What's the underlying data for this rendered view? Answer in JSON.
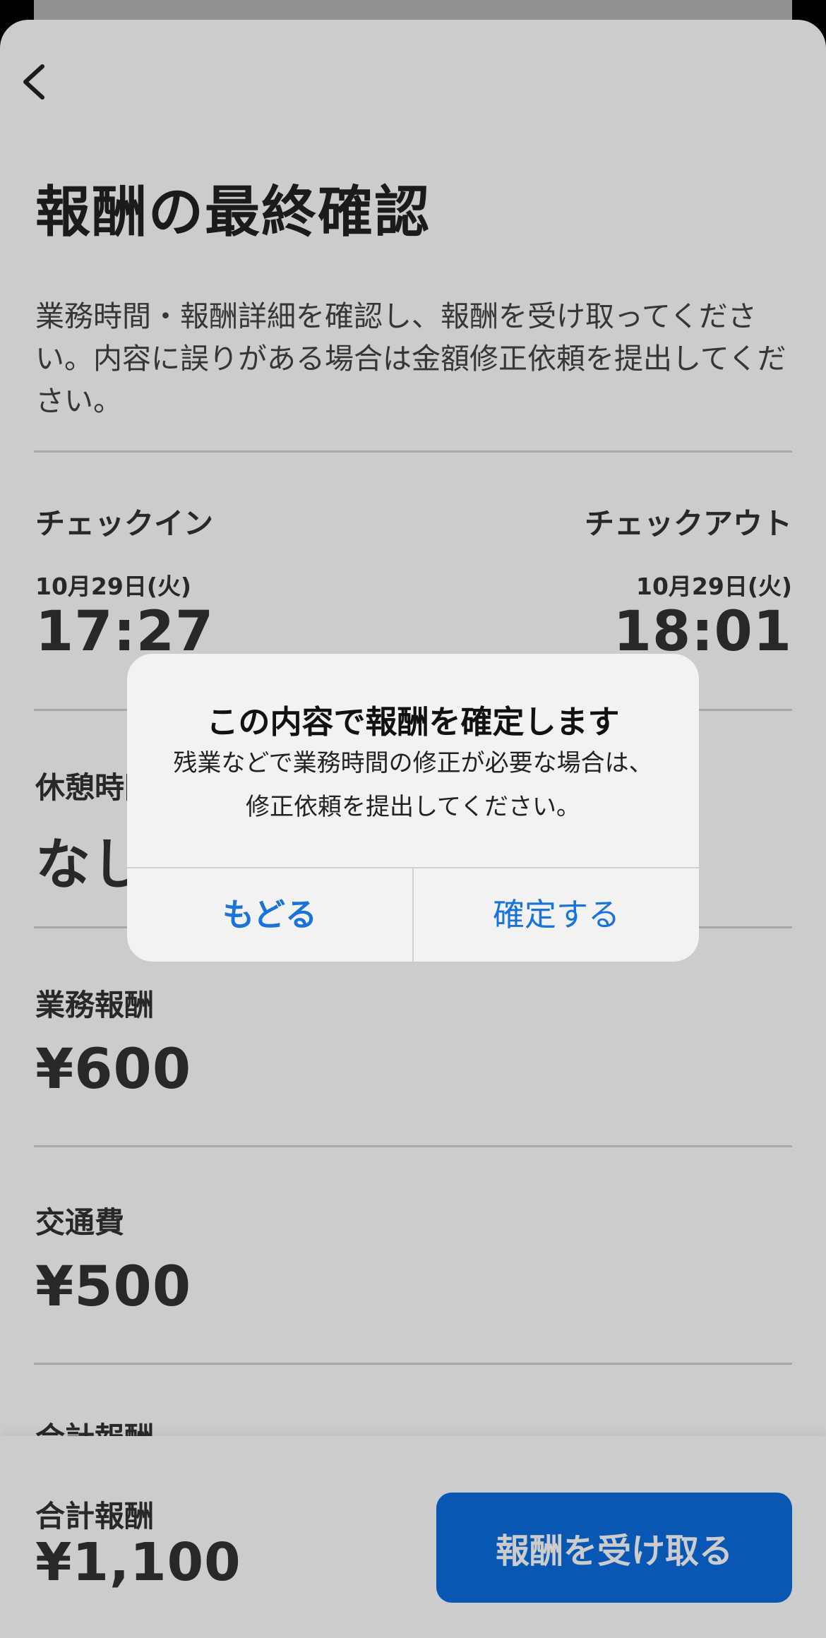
{
  "page": {
    "title": "報酬の最終確認",
    "description": "業務時間・報酬詳細を確認し、報酬を受け取ってください。内容に誤りがある場合は金額修正依頼を提出してください。"
  },
  "checkin": {
    "label": "チェックイン",
    "date": "10月29日(火)",
    "time": "17:27"
  },
  "checkout": {
    "label": "チェックアウト",
    "date": "10月29日(火)",
    "time": "18:01"
  },
  "break": {
    "label": "休憩時間",
    "value": "なし"
  },
  "work_pay": {
    "label": "業務報酬",
    "value": "¥600"
  },
  "transport": {
    "label": "交通費",
    "value": "¥500"
  },
  "total_peek": {
    "label": "合計報酬"
  },
  "bottom": {
    "total_label": "合計報酬",
    "total_value": "¥1,100",
    "cta_label": "報酬を受け取る"
  },
  "dialog": {
    "title": "この内容で報酬を確定します",
    "message_line1": "残業などで業務時間の修正が必要な場合は、",
    "message_line2": "修正依頼を提出してください。",
    "cancel_label": "もどる",
    "confirm_label": "確定する"
  },
  "colors": {
    "accent": "#0a6de0",
    "dialog_button": "#1a73d9"
  },
  "icons": {
    "back": "chevron-left-icon"
  }
}
